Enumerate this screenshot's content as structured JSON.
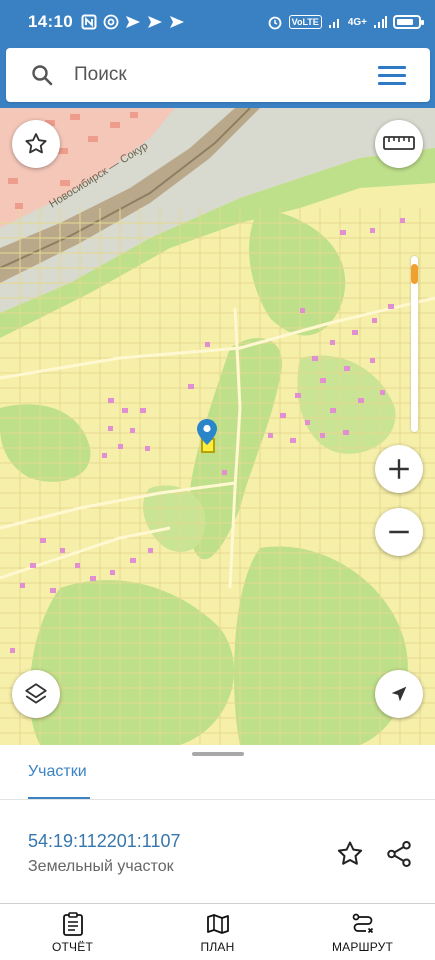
{
  "status_bar": {
    "time": "14:10",
    "left_icons": [
      "nfc-icon",
      "at-icon",
      "send-icon",
      "send-icon",
      "send-icon"
    ],
    "right_labels": {
      "volte": "VoLTE",
      "network": "4G+"
    },
    "battery_percent": 80
  },
  "search": {
    "placeholder": "Поиск"
  },
  "map": {
    "road_label": "Новосибирск — Сокур",
    "zoom_level_fraction": 0.05,
    "colors": {
      "parcel_fill": "#f6efaa",
      "vegetation": "#bfe08a",
      "buildings": "#e28fd2",
      "road": "#b9a98a",
      "accent_slider": "#f0a030",
      "pin": "#2a86c9"
    }
  },
  "sheet": {
    "tab_label": "Участки",
    "parcel_number": "54:19:112201:1107",
    "parcel_type": "Земельный участок",
    "accent": "#3b83c3"
  },
  "bottom_nav": {
    "items": [
      {
        "label": "ОТЧЁТ",
        "icon": "clipboard-icon"
      },
      {
        "label": "ПЛАН",
        "icon": "map-icon"
      },
      {
        "label": "МАРШРУТ",
        "icon": "route-icon"
      }
    ]
  }
}
